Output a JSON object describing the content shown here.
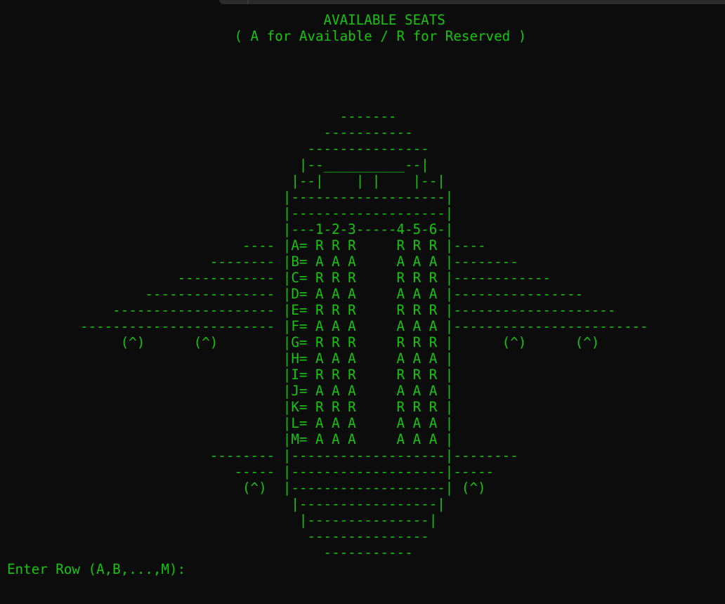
{
  "terminal": {
    "title": "                                       AVAILABLE SEATS",
    "subtitle": "                            ( A for Available / R for Reserved )",
    "art": "                                         -------\n                                       -----------\n                                     ---------------\n                                    |--__________--|\n                                   |--|    | |    |--|\n                                  |-------------------|\n                                  |-------------------|\n                                  |---1-2-3-----4-5-6-|\n                             ---- |A= R R R     R R R |----\n                         -------- |B= A A A     A A A |--------\n                     ------------ |C= R R R     R R R |------------\n                 ---------------- |D= A A A     A A A |----------------\n             -------------------- |E= R R R     R R R |--------------------\n         ------------------------ |F= A A A     A A A |------------------------\n              (^)      (^)        |G= R R R     R R R |      (^)      (^)\n                                  |H= A A A     A A A |\n                                  |I= R R R     R R R |\n                                  |J= A A A     A A A |\n                                  |K= R R R     R R R |\n                                  |L= A A A     A A A |\n                                  |M= A A A     A A A |\n                         -------- |-------------------|--------\n                            ----- |-------------------|-----\n                             (^)  |-------------------| (^)\n                                   |-----------------|\n                                    |---------------|\n                                     ---------------\n                                       -----------",
    "prompt": "Enter Row (A,B,...,M): ",
    "text_color": "#16c60c",
    "background_color": "#0c0c0c"
  }
}
